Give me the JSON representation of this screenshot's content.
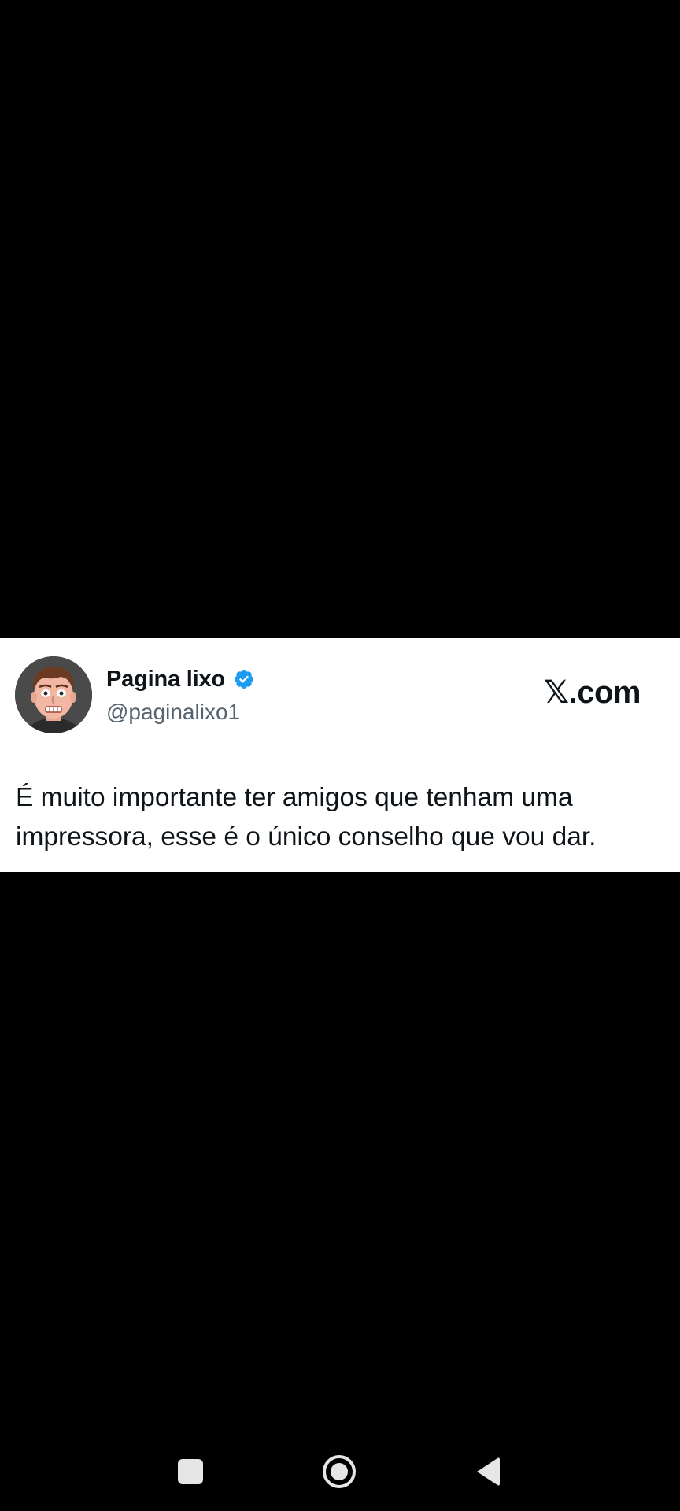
{
  "tweet": {
    "display_name": "Pagina lixo",
    "handle": "@paginalixo1",
    "verified": true,
    "site_logo": "𝕏.com",
    "text": "É muito importante ter amigos que tenham uma impressora, esse é o único conselho que vou dar.",
    "avatar_icon": "cartoon-face-avatar"
  },
  "nav_bar": {
    "recents_icon": "square-icon",
    "home_icon": "circle-icon",
    "back_icon": "triangle-back-icon"
  },
  "colors": {
    "background": "#000000",
    "card": "#ffffff",
    "text_primary": "#0f1419",
    "text_secondary": "#536471",
    "verified_blue": "#1d9bf0",
    "nav_icon": "#e6e6e6"
  }
}
